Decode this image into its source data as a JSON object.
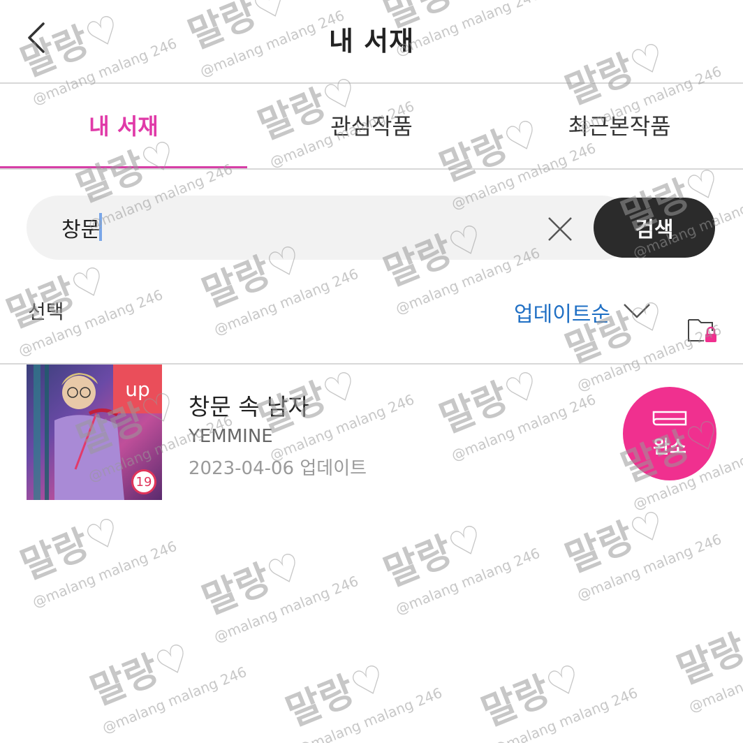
{
  "header": {
    "title": "내 서재"
  },
  "tabs": [
    {
      "label": "내 서재",
      "active": true
    },
    {
      "label": "관심작품",
      "active": false
    },
    {
      "label": "최근본작품",
      "active": false
    }
  ],
  "search": {
    "value": "창문",
    "button_label": "검색"
  },
  "toolbar": {
    "select_label": "선택",
    "sort_label": "업데이트순"
  },
  "items": [
    {
      "title": "창문 속 남자",
      "author": "YEMMINE",
      "updated": "2023-04-06 업데이트",
      "badge": "up",
      "age_rating": "19",
      "status_label": "완소"
    }
  ],
  "watermark": {
    "text": "말랑♡",
    "handle": "@malang malang 246"
  },
  "colors": {
    "accent": "#e03aa8",
    "sort_link": "#1f6fc4",
    "complete": "#f0308f",
    "search_button": "#2b2b2b"
  }
}
